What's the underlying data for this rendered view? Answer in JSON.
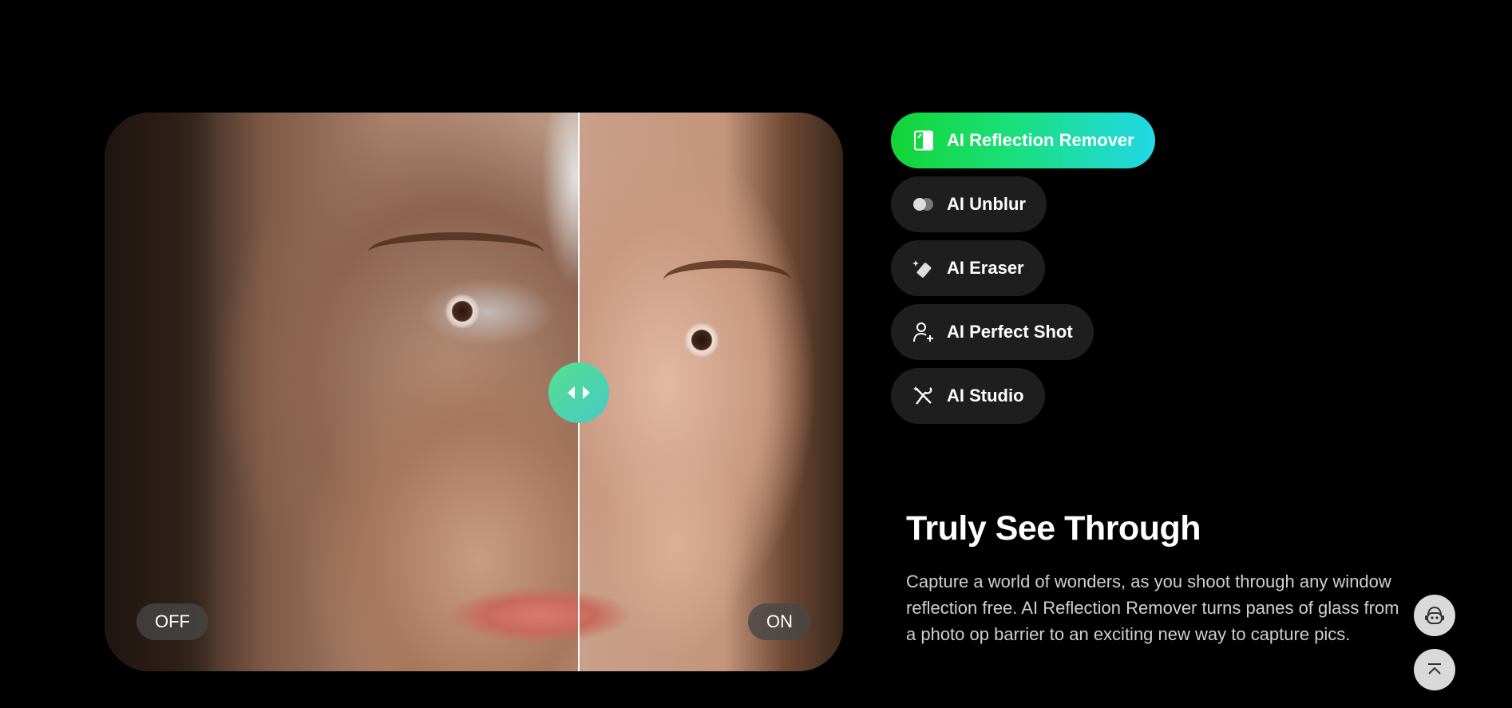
{
  "compare": {
    "off_label": "OFF",
    "on_label": "ON",
    "divider_percent": 64
  },
  "menu": {
    "items": [
      {
        "label": "AI Reflection Remover",
        "icon": "reflection-remover-icon",
        "active": true
      },
      {
        "label": "AI Unblur",
        "icon": "unblur-icon",
        "active": false
      },
      {
        "label": "AI Eraser",
        "icon": "eraser-icon",
        "active": false
      },
      {
        "label": "AI Perfect Shot",
        "icon": "perfect-shot-icon",
        "active": false
      },
      {
        "label": "AI Studio",
        "icon": "studio-icon",
        "active": false
      }
    ]
  },
  "content": {
    "headline": "Truly See Through",
    "description": "Capture a world of wonders, as you shoot through any window reflection free. AI Reflection Remover turns panes of glass from a photo op barrier to an exciting new way to capture pics."
  },
  "floating": {
    "support_icon": "support-bot-icon",
    "back_to_top_icon": "back-to-top-icon"
  },
  "colors": {
    "accent_gradient_start": "#13d435",
    "accent_gradient_end": "#22d8e6",
    "handle_start": "#57e08e",
    "handle_end": "#45c9c6",
    "menu_bg": "#1e1e1e",
    "page_bg": "#000000"
  }
}
